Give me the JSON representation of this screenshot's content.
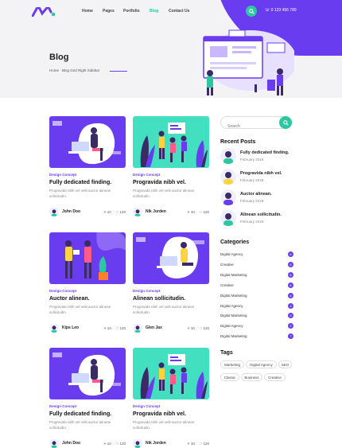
{
  "header": {
    "nav": [
      "Home",
      "Pages",
      "Portfolio",
      "Blog",
      "Contact Us"
    ],
    "active_index": 3,
    "phone": "0 123 456 789"
  },
  "hero": {
    "title": "Blog",
    "breadcrumb": "Home · Blog Grid Right Sidebar"
  },
  "posts": [
    {
      "category": "Design Concept",
      "title": "Fully dedicated finding.",
      "excerpt": "Progravida nibh vel velit auctor alinean sollicitudin.",
      "author": "John Doo",
      "likes": "10",
      "comments": "120"
    },
    {
      "category": "Design Concept",
      "title": "Progravida nibh vel.",
      "excerpt": "Progravida nibh vel velit auctor alinean sollicitudin.",
      "author": "Nik Jorden",
      "likes": "10",
      "comments": "120"
    },
    {
      "category": "Design Concept",
      "title": "Auctor alinean.",
      "excerpt": "Progravida nibh vel velit auctor alinean sollicitudin.",
      "author": "Kips Leo",
      "likes": "10",
      "comments": "120"
    },
    {
      "category": "Design Concept",
      "title": "Alinean sollicitudin.",
      "excerpt": "Progravida nibh vel velit auctor alinean sollicitudin.",
      "author": "Glen Jax",
      "likes": "10",
      "comments": "120"
    },
    {
      "category": "Design Concept",
      "title": "Fully dedicated finding.",
      "excerpt": "Progravida nibh vel velit auctor alinean sollicitudin.",
      "author": "John Doo",
      "likes": "10",
      "comments": "120"
    },
    {
      "category": "Design Concept",
      "title": "Progravida nibh vel.",
      "excerpt": "Progravida nibh vel velit auctor alinean sollicitudin.",
      "author": "Nik Jorden",
      "likes": "10",
      "comments": "120"
    }
  ],
  "sidebar": {
    "search_placeholder": "Search",
    "recent_title": "Recent Posts",
    "recent": [
      {
        "title": "Fully dedicated finding.",
        "date": "February 2018"
      },
      {
        "title": "Progravida nibh vel.",
        "date": "February 2018"
      },
      {
        "title": "Auctor alinean.",
        "date": "February 2018"
      },
      {
        "title": "Alinean sollicitudin.",
        "date": "February 2018"
      }
    ],
    "categories_title": "Categories",
    "categories": [
      {
        "label": "Digital Agency",
        "count": "6"
      },
      {
        "label": "Creative",
        "count": "6"
      },
      {
        "label": "Digital Marketing",
        "count": "6"
      },
      {
        "label": "Creative",
        "count": "6"
      },
      {
        "label": "Digital Marketing",
        "count": "6"
      },
      {
        "label": "Digital Agency",
        "count": "4"
      },
      {
        "label": "Digital Marketing",
        "count": "5"
      },
      {
        "label": "Digital Agency",
        "count": "2"
      },
      {
        "label": "Digital Marketing",
        "count": "7"
      }
    ],
    "tags_title": "Tags",
    "tags": [
      "Marketing",
      "Digital Agency",
      "SEO",
      "Classic",
      "Business",
      "Creative"
    ]
  },
  "colors": {
    "primary": "#6a3cf0",
    "accent": "#2cc7a0"
  }
}
